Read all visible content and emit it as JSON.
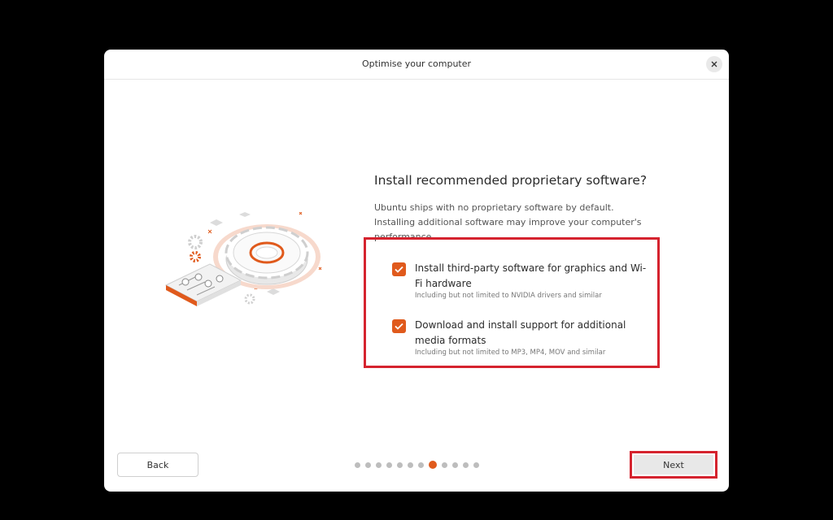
{
  "window": {
    "title": "Optimise your computer",
    "close_icon": "close-icon"
  },
  "main": {
    "heading": "Install recommended proprietary software?",
    "description": "Ubuntu ships with no proprietary software by default. Installing additional software may improve your computer's performance.",
    "options": [
      {
        "label": "Install third-party software for graphics and Wi-Fi hardware",
        "sublabel": "Including but not limited to NVIDIA drivers and similar",
        "checked": true
      },
      {
        "label": "Download and install support for additional media formats",
        "sublabel": "Including but not limited to MP3, MP4, MOV and similar",
        "checked": true
      }
    ]
  },
  "footer": {
    "back_label": "Back",
    "next_label": "Next",
    "pagination": {
      "total": 12,
      "current": 8
    }
  },
  "colors": {
    "accent": "#E95420",
    "highlight_border": "#D5232E"
  }
}
